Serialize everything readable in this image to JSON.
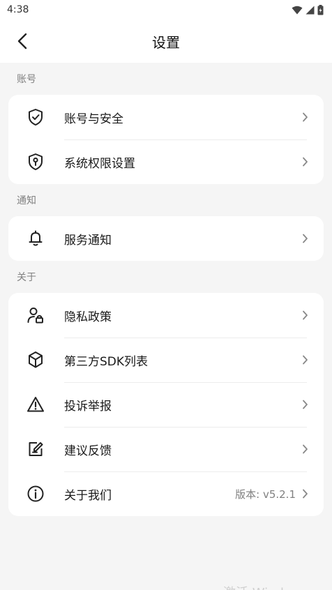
{
  "status_bar": {
    "time": "4:38"
  },
  "header": {
    "title": "设置"
  },
  "sections": {
    "account": {
      "label": "账号",
      "items": [
        {
          "label": "账号与安全",
          "icon": "shield-check-icon"
        },
        {
          "label": "系统权限设置",
          "icon": "shield-key-icon"
        }
      ]
    },
    "notify": {
      "label": "通知",
      "items": [
        {
          "label": "服务通知",
          "icon": "bell-icon"
        }
      ]
    },
    "about": {
      "label": "关于",
      "items": [
        {
          "label": "隐私政策",
          "icon": "user-lock-icon"
        },
        {
          "label": "第三方SDK列表",
          "icon": "cube-icon"
        },
        {
          "label": "投诉举报",
          "icon": "warning-icon"
        },
        {
          "label": "建议反馈",
          "icon": "edit-note-icon"
        },
        {
          "label": "关于我们",
          "icon": "info-icon",
          "value": "版本: v5.2.1"
        }
      ]
    }
  },
  "footer": {
    "text": "激活 Windows"
  },
  "colors": {
    "background": "#f5f5f5",
    "card": "#ffffff",
    "secondary_text": "#808080"
  }
}
